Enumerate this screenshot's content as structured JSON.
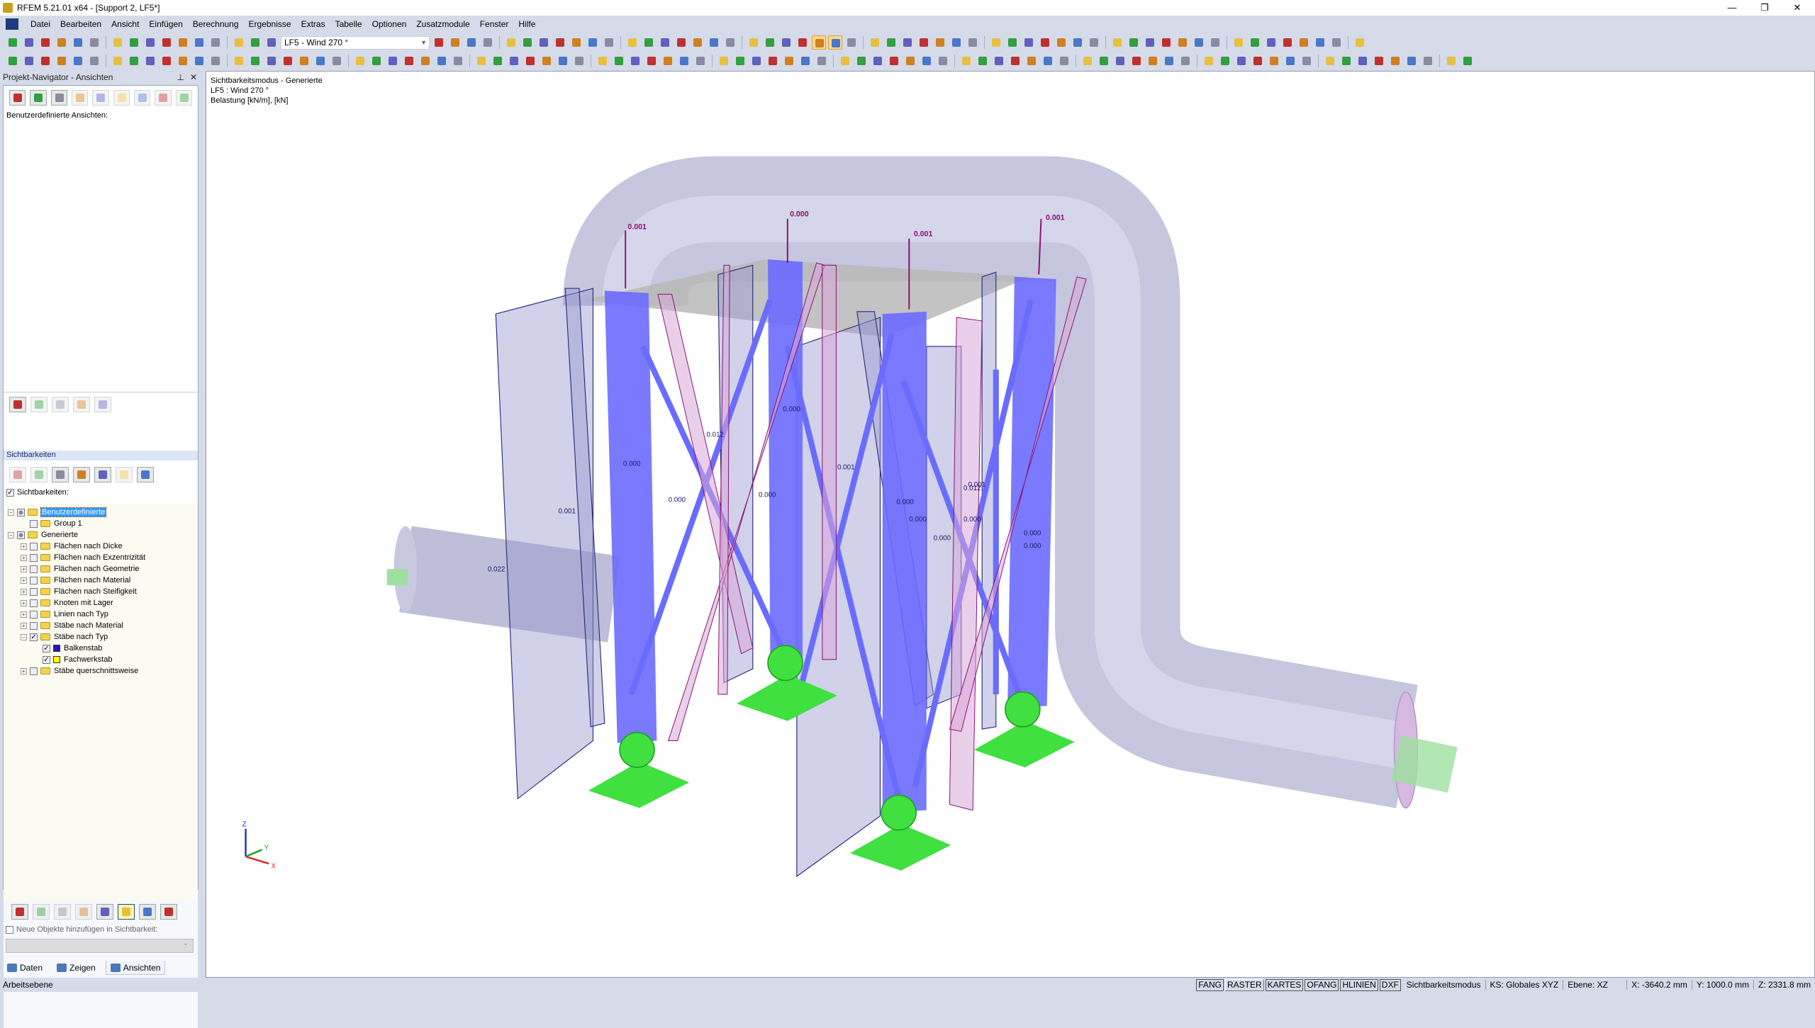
{
  "window": {
    "title": "RFEM 5.21.01 x64 - [Support 2, LF5*]",
    "minimize": "—",
    "restore": "❐",
    "close": "✕"
  },
  "menu": [
    "Datei",
    "Bearbeiten",
    "Ansicht",
    "Einfügen",
    "Berechnung",
    "Ergebnisse",
    "Extras",
    "Tabelle",
    "Optionen",
    "Zusatzmodule",
    "Fenster",
    "Hilfe"
  ],
  "toolbar": {
    "loadcase": "LF5 - Wind 270 °"
  },
  "navigator": {
    "title": "Projekt-Navigator - Ansichten",
    "custom_views_label": "Benutzerdefinierte Ansichten:",
    "visibilities_header": "Sichtbarkeiten",
    "visibilities_checkbox": "Sichtbarkeiten:",
    "tree": [
      {
        "label": "Benutzerdefinierte",
        "level": 0,
        "exp": "−",
        "check": "part",
        "selected": true
      },
      {
        "label": "Group 1",
        "level": 1,
        "check": "off"
      },
      {
        "label": "Generierte",
        "level": 0,
        "exp": "−",
        "check": "part"
      },
      {
        "label": "Flächen nach Dicke",
        "level": 1,
        "exp": "+",
        "check": "off"
      },
      {
        "label": "Flächen nach Exzentrizität",
        "level": 1,
        "exp": "+",
        "check": "off"
      },
      {
        "label": "Flächen nach Geometrie",
        "level": 1,
        "exp": "+",
        "check": "off"
      },
      {
        "label": "Flächen nach Material",
        "level": 1,
        "exp": "+",
        "check": "off"
      },
      {
        "label": "Flächen nach Steifigkeit",
        "level": 1,
        "exp": "+",
        "check": "off"
      },
      {
        "label": "Knoten mit Lager",
        "level": 1,
        "exp": "+",
        "check": "off"
      },
      {
        "label": "Linien nach Typ",
        "level": 1,
        "exp": "+",
        "check": "off"
      },
      {
        "label": "Stäbe nach Material",
        "level": 1,
        "exp": "+",
        "check": "off"
      },
      {
        "label": "Stäbe nach Typ",
        "level": 1,
        "exp": "−",
        "check": "on"
      },
      {
        "label": "Balkenstab",
        "level": 2,
        "check": "on",
        "swatch": "#2a12c8"
      },
      {
        "label": "Fachwerkstab",
        "level": 2,
        "check": "on",
        "swatch": "#ffff00"
      },
      {
        "label": "Stäbe querschnittsweise",
        "level": 1,
        "exp": "+",
        "check": "off"
      }
    ],
    "new_objects_label": "Neue Objekte hinzufügen in Sichtbarkeit:",
    "tabs": [
      "Daten",
      "Zeigen",
      "Ansichten"
    ]
  },
  "viewport": {
    "info": [
      "Sichtbarkeitsmodus - Generierte",
      "LF5 : Wind 270 °",
      "Belastung [kN/m], [kN]"
    ],
    "loads_major": [
      "0.001",
      "0.000",
      "0.001",
      "0.001"
    ],
    "loads_minor": [
      "0.000",
      "0.000",
      "0.001",
      "0.012",
      "0.000",
      "0.000",
      "0.001",
      "0.022",
      "0.000",
      "0.000",
      "0.000",
      "0.012",
      "0.000",
      "0.000",
      "0.001",
      "0.000"
    ],
    "axes": {
      "x": "X",
      "y": "Y",
      "z": "Z"
    }
  },
  "statusbar": {
    "left": "Arbeitsebene",
    "toggles": [
      "FANG",
      "RASTER",
      "KARTES",
      "OFANG",
      "HLINIEN",
      "DXF"
    ],
    "mode": "Sichtbarkeitsmodus",
    "cs": "KS: Globales XYZ",
    "plane": "Ebene: XZ",
    "x": "X:  -3640.2 mm",
    "y": "Y:  1000.0 mm",
    "z": "Z:  2331.8 mm"
  },
  "colors": {
    "column": "#6a6cff",
    "panel": "#2a2a7a",
    "load": "#8a1070",
    "support": "#3fe040",
    "pipe": "#c4c4dc"
  }
}
